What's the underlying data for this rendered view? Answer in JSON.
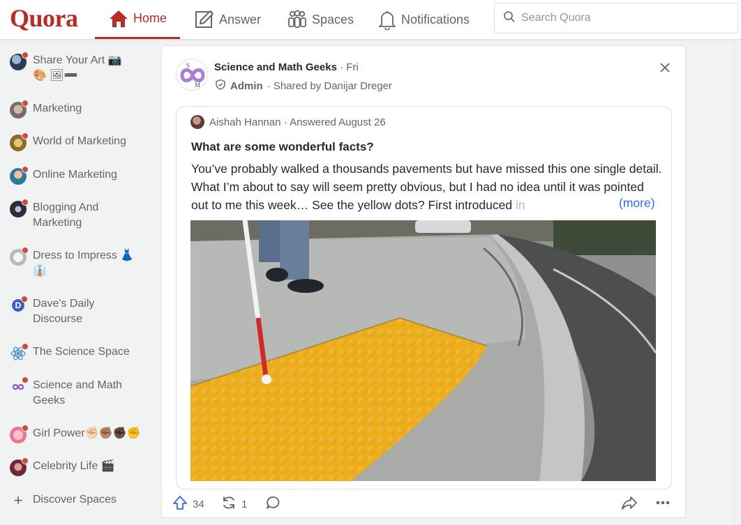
{
  "header": {
    "logo": "Quora",
    "nav": {
      "home": "Home",
      "answer": "Answer",
      "spaces": "Spaces",
      "notifications": "Notifications"
    },
    "search_placeholder": "Search Quora"
  },
  "sidebar": {
    "items": [
      {
        "label": "Share Your Art 📷",
        "label2": "🎨 🖼➖"
      },
      {
        "label": "Marketing"
      },
      {
        "label": "World of Marketing"
      },
      {
        "label": "Online Marketing"
      },
      {
        "label": "Blogging And",
        "label2": "Marketing"
      },
      {
        "label": "Dress to Impress 👗",
        "label2": "👔"
      },
      {
        "label": "Dave's Daily",
        "label2": "Discourse",
        "avatar_letter": "D"
      },
      {
        "label": "The Science Space"
      },
      {
        "label": "Science and Math",
        "label2": "Geeks"
      },
      {
        "label": "Girl Power✊🏻✊🏽✊🏿✊"
      },
      {
        "label": "Celebrity Life 🎬"
      }
    ],
    "discover": "Discover Spaces"
  },
  "post": {
    "space_name": "Science and Math Geeks",
    "time": "· Fri",
    "role": "Admin",
    "shared_by": "· Shared by Danijar Dreger",
    "space_logo_letters": [
      "S",
      "M"
    ],
    "author": "Aishah Hannan · Answered August 26",
    "question": "What are some wonderful facts?",
    "answer": "You’ve probably walked a thousands pavements but have missed this one single detail. What I’m about to say will seem pretty obvious, but I had no idea until it was pointed out to me this week… See the yellow dots? First introduced ",
    "answer_fade": "in",
    "more": "(more)"
  },
  "actions": {
    "upvotes": "34",
    "shares": "1"
  },
  "colors": {
    "brand": "#b92b27",
    "link": "#2e69ff",
    "text": "#282829",
    "muted": "#636466",
    "tactile_yellow": "#f2b51c"
  }
}
